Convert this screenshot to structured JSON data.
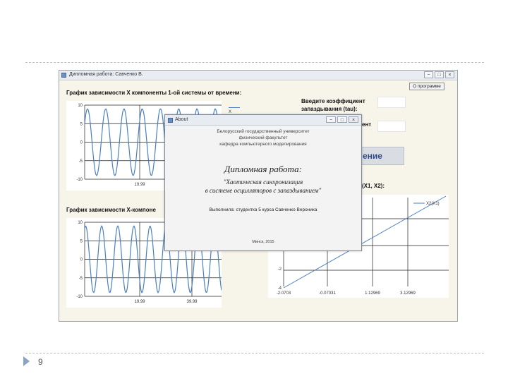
{
  "slide": {
    "number": "9"
  },
  "app": {
    "title": "Дипломная работа: Савченко В.",
    "window_buttons": [
      "−",
      "□",
      "×"
    ],
    "program_button": "О программе"
  },
  "top_chart": {
    "label": "График зависимости X компоненты 1-ой системы от времени:",
    "y_ticks": [
      "10",
      "5",
      "0",
      "-5",
      "-10"
    ],
    "x_ticks": [
      "19.99"
    ],
    "legend": "X"
  },
  "bottom_chart": {
    "label": "График зависимости X-компоне",
    "y_ticks": [
      "10",
      "5",
      "0",
      "-5",
      "-10"
    ],
    "x_ticks": [
      "19.99",
      "39.99"
    ]
  },
  "controls": {
    "tau_label_1": "Введите коэффициент",
    "tau_label_2": "запаздывания (tau):",
    "coef_label_tail": "ент",
    "calc_button_tail": "ение"
  },
  "phase_chart": {
    "label_tail": "(X1, X2):",
    "legend": "X2(X1)",
    "y_ticks": [
      "-2",
      "-4"
    ],
    "x_ticks": [
      "-2.0703",
      "-0.07031",
      "1.12969",
      "3.12969"
    ]
  },
  "about": {
    "title": "About",
    "window_buttons": [
      "−",
      "□",
      "×"
    ],
    "institution_1": "Белорусский государственный университет",
    "institution_2": "физический факультет",
    "institution_3": "кафедра компьютерного моделирования",
    "thesis_title": "Дипломная работа:",
    "topic_1": "\"Хаотическая синхронизация",
    "topic_2": "в системе осцилляторов с запаздыванием\"",
    "author": "Выполнила: студентка 5 курса Савченко Вероника",
    "city_year": "Минск, 2015"
  },
  "colors": {
    "curve": "#4a7fc1",
    "window_bg": "#f7f4ea",
    "accent_text": "#2b4a8c"
  },
  "chart_data": [
    {
      "type": "line",
      "title": "График зависимости X компоненты 1-ой системы от времени:",
      "series": [
        {
          "name": "X",
          "description_shape": "oscillation",
          "amplitude": 9
        }
      ],
      "ylim": [
        -10,
        10
      ],
      "y_ticks": [
        10,
        5,
        0,
        -5,
        -10
      ],
      "x_ticks": [
        19.99
      ]
    },
    {
      "type": "line",
      "title": "График зависимости X-компоне",
      "series": [
        {
          "amplitude": 9
        }
      ],
      "ylim": [
        -10,
        10
      ],
      "y_ticks": [
        10,
        5,
        0,
        -5,
        -10
      ],
      "x_ticks": [
        19.99,
        39.99
      ]
    },
    {
      "type": "line",
      "title": "(X1, X2):",
      "series": [
        {
          "name": "X2(X1)",
          "x": [
            -2.0703,
            3.12969
          ],
          "y": [
            -4,
            4
          ]
        }
      ],
      "y_ticks": [
        -2,
        -4
      ],
      "x_ticks": [
        -2.0703,
        -0.07031,
        1.12969,
        3.12969
      ]
    }
  ]
}
